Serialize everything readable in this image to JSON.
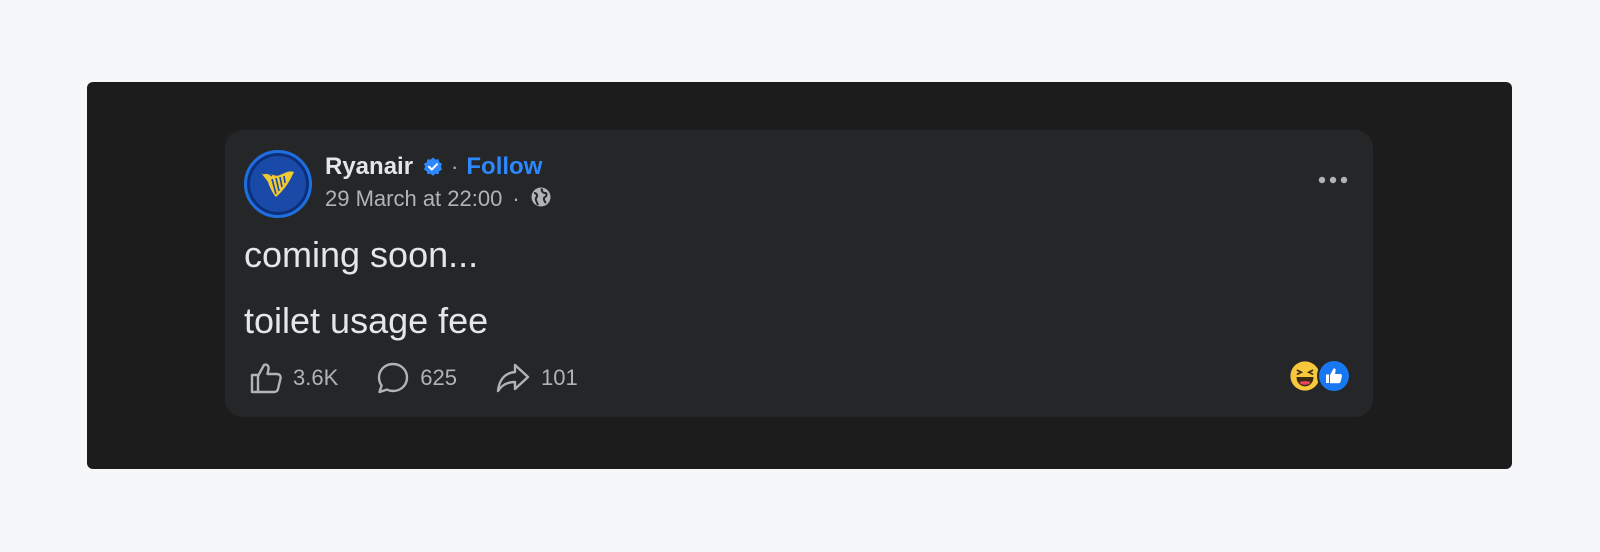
{
  "post": {
    "page_name": "Ryanair",
    "verified": true,
    "follow_label": "Follow",
    "separator": "·",
    "timestamp": "29 March at 22:00",
    "audience_icon": "globe-icon",
    "body_lines": [
      "coming soon...",
      "toilet usage fee"
    ],
    "actions": {
      "like_count": "3.6K",
      "comment_count": "625",
      "share_count": "101"
    },
    "reactions": [
      "laugh-emoji",
      "like-reaction"
    ]
  },
  "colors": {
    "frame_bg": "#1c1c1d",
    "card_bg": "#252628",
    "text_primary": "#e4e6eb",
    "text_secondary": "#b0b3b8",
    "accent_blue": "#2d88ff",
    "brand_navy": "#1a4aa8",
    "brand_yellow": "#f1c933"
  }
}
